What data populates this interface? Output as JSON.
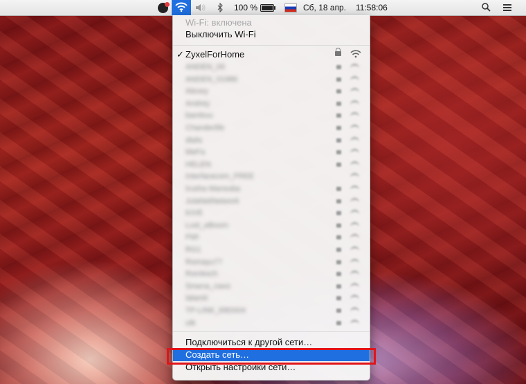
{
  "menubar": {
    "battery_percent": "100 %",
    "battery_level": 1.0,
    "date": "Сб, 18 апр.",
    "time": "11:58:06",
    "icons": {
      "vpn": "vpn-status-icon",
      "wifi": "wifi-icon",
      "volume": "volume-icon",
      "bluetooth": "bluetooth-icon",
      "battery": "battery-charging-icon",
      "input_source": "russia-flag-icon",
      "search": "spotlight-search-icon",
      "notifications": "notification-center-icon"
    }
  },
  "wifi_menu": {
    "status_label": "Wi-Fi: включена",
    "turn_off_label": "Выключить Wi-Fi",
    "current_network": {
      "checkmark": "✓",
      "name": "ZyxelForHome",
      "secured": true
    },
    "networks": [
      {
        "name": "ANDEN_09",
        "secured": true
      },
      {
        "name": "ANDEN_01986",
        "secured": true
      },
      {
        "name": "Alexey",
        "secured": true
      },
      {
        "name": "Andrey",
        "secured": true
      },
      {
        "name": "bambuu",
        "secured": true
      },
      {
        "name": "Chanderlife",
        "secured": true
      },
      {
        "name": "dlafa",
        "secured": true
      },
      {
        "name": "MeFa",
        "secured": true
      },
      {
        "name": "HELEN",
        "secured": true
      },
      {
        "name": "Interfacecom_FREE",
        "secured": false
      },
      {
        "name": "Irusha Mansuba",
        "secured": true
      },
      {
        "name": "JulaNetNetwork",
        "secured": true
      },
      {
        "name": "KIVE",
        "secured": true
      },
      {
        "name": "Lust_eBoom",
        "secured": true
      },
      {
        "name": "FMI",
        "secured": true
      },
      {
        "name": "RG1",
        "secured": true
      },
      {
        "name": "Romayu77",
        "secured": true
      },
      {
        "name": "Romkoch",
        "secured": true
      },
      {
        "name": "Smena_navo",
        "secured": true
      },
      {
        "name": "lalamit",
        "secured": true
      },
      {
        "name": "TP-LINK_69D004",
        "secured": true
      },
      {
        "name": "utk",
        "secured": true
      }
    ],
    "join_other_label": "Подключиться к другой сети…",
    "create_network_label": "Создать сеть…",
    "open_prefs_label": "Открыть настройки сети…"
  },
  "colors": {
    "selection_blue": "#1f6fe0",
    "highlight_red": "#e0141a"
  }
}
